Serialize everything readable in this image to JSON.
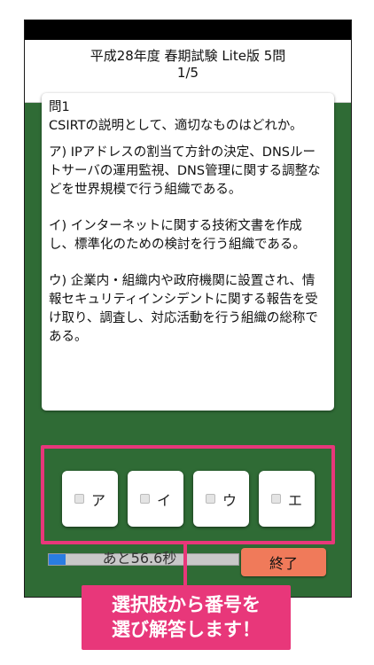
{
  "header": {
    "title": "平成28年度 春期試験 Lite版 5問",
    "progress": "1/5"
  },
  "question": {
    "number": "問1",
    "stem": "CSIRTの説明として、適切なものはどれか。",
    "choices": [
      "ア) IPアドレスの割当て方針の決定、DNSルートサーバの運用監視、DNS管理に関する調整などを世界規模で行う組織である。",
      "イ) インターネットに関する技術文書を作成し、標準化のための検討を行う組織である。",
      "ウ) 企業内・組織内や政府機関に設置され、情報セキュリティインシデントに関する報告を受け取り、調査し、対応活動を行う組織の総称である。"
    ]
  },
  "answers": [
    {
      "label": "ア",
      "checked": false
    },
    {
      "label": "イ",
      "checked": false
    },
    {
      "label": "ウ",
      "checked": false
    },
    {
      "label": "エ",
      "checked": false
    }
  ],
  "timer": {
    "text": "あと56.6秒",
    "progress": 0.09
  },
  "end_button": {
    "label": "終了"
  },
  "callout": {
    "line1": "選択肢から番号を",
    "line2": "選び解答します！"
  },
  "colors": {
    "background_green": "#2f6b35",
    "accent_pink": "#e8377a",
    "end_button": "#f07a5a",
    "timer_fill": "#2a7de1"
  }
}
